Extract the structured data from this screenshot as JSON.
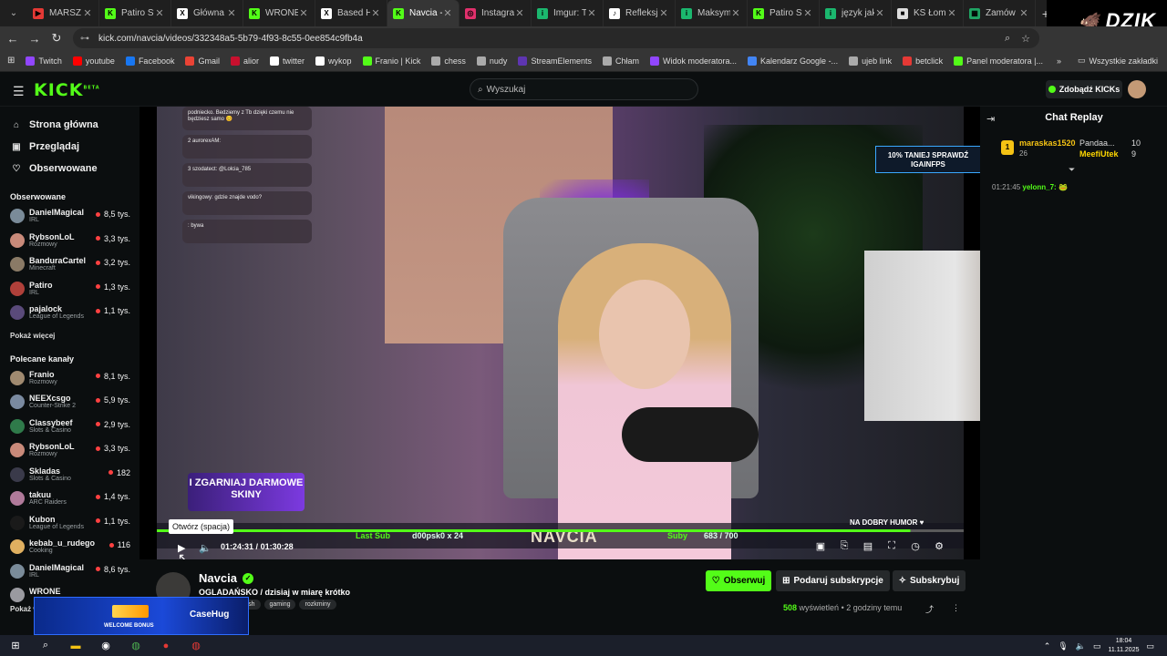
{
  "browser": {
    "tabs": [
      {
        "label": "MARSZ N",
        "color": "#e53935",
        "glyph": "▶"
      },
      {
        "label": "Patiro St",
        "color": "#53fc18",
        "glyph": "K"
      },
      {
        "label": "Główna /",
        "color": "#ffffff",
        "glyph": "X"
      },
      {
        "label": "WRONE",
        "color": "#53fc18",
        "glyph": "K"
      },
      {
        "label": "Based H",
        "color": "#ffffff",
        "glyph": "X"
      },
      {
        "label": "Navcia -",
        "color": "#53fc18",
        "glyph": "K"
      },
      {
        "label": "Instagran",
        "color": "#e1306c",
        "glyph": "◎"
      },
      {
        "label": "Imgur: Th",
        "color": "#1bb76e",
        "glyph": "i"
      },
      {
        "label": "Refleksje",
        "color": "#ffffff",
        "glyph": "♪"
      },
      {
        "label": "Maksym",
        "color": "#1bb76e",
        "glyph": "i"
      },
      {
        "label": "Patiro St",
        "color": "#53fc18",
        "glyph": "K"
      },
      {
        "label": "język jak",
        "color": "#1bb76e",
        "glyph": "i"
      },
      {
        "label": "KS Łomia",
        "color": "#dddddd",
        "glyph": "■"
      },
      {
        "label": "Zamów",
        "color": "#1fa463",
        "glyph": "▦"
      }
    ],
    "active_tab": 5,
    "new_tab": "+",
    "url": "kick.com/navcia/videos/332348a5-5b79-4f93-8c55-0ee854c9fb4a",
    "bookmarks": [
      {
        "label": "Twitch",
        "color": "#9146ff"
      },
      {
        "label": "youtube",
        "color": "#ff0000"
      },
      {
        "label": "Facebook",
        "color": "#1877f2"
      },
      {
        "label": "Gmail",
        "color": "#ea4335"
      },
      {
        "label": "alior",
        "color": "#c8102e"
      },
      {
        "label": "twitter",
        "color": "#ffffff"
      },
      {
        "label": "wykop",
        "color": "#ffffff"
      },
      {
        "label": "Franio | Kick",
        "color": "#53fc18"
      },
      {
        "label": "chess",
        "color": "#aaaaaa"
      },
      {
        "label": "nudy",
        "color": "#aaaaaa"
      },
      {
        "label": "StreamElements",
        "color": "#5e35b1"
      },
      {
        "label": "Chłam",
        "color": "#aaaaaa"
      },
      {
        "label": "Widok moderatora...",
        "color": "#9146ff"
      },
      {
        "label": "Kalendarz Google -...",
        "color": "#4285f4"
      },
      {
        "label": "ujeb link",
        "color": "#aaaaaa"
      },
      {
        "label": "betclick",
        "color": "#e53935"
      },
      {
        "label": "Panel moderatora |...",
        "color": "#53fc18"
      }
    ],
    "all_bookmarks": "Wszystkie zakładki",
    "dzik_logo": "DZIK"
  },
  "header": {
    "logo": "KICK",
    "logo_sup": "BETA",
    "search_placeholder": "Wyszukaj",
    "kicks_label": "Zdobądź KICKs"
  },
  "sidebar": {
    "nav": [
      {
        "label": "Strona główna",
        "icon": "home-icon",
        "glyph": "⌂"
      },
      {
        "label": "Przeglądaj",
        "icon": "browse-icon",
        "glyph": "▣"
      },
      {
        "label": "Obserwowane",
        "icon": "heart-icon",
        "glyph": "♡"
      }
    ],
    "followed_title": "Obserwowane",
    "followed": [
      {
        "name": "DanielMagical",
        "cat": "IRL",
        "viewers": "8,5 tys.",
        "color": "#7a8b99"
      },
      {
        "name": "RybsonLoL",
        "cat": "Rozmowy",
        "viewers": "3,3 tys.",
        "color": "#c98a7a"
      },
      {
        "name": "BanduraCartel",
        "cat": "Minecraft",
        "viewers": "3,2 tys.",
        "color": "#8a7a66"
      },
      {
        "name": "Patiro",
        "cat": "IRL",
        "viewers": "1,3 tys.",
        "color": "#b0403a"
      },
      {
        "name": "pajalock",
        "cat": "League of Legends",
        "viewers": "1,1 tys.",
        "color": "#5a4a7a"
      }
    ],
    "show_more": "Pokaż więcej",
    "recommended_title": "Polecane kanały",
    "recommended": [
      {
        "name": "Franio",
        "cat": "Rozmowy",
        "viewers": "8,1 tys.",
        "color": "#a08a70"
      },
      {
        "name": "NEEXcsgo",
        "cat": "Counter-Strike 2",
        "viewers": "5,9 tys.",
        "color": "#7a8aa0"
      },
      {
        "name": "Classybeef",
        "cat": "Slots & Casino",
        "viewers": "2,9 tys.",
        "color": "#2f7a4a"
      },
      {
        "name": "RybsonLoL",
        "cat": "Rozmowy",
        "viewers": "3,3 tys.",
        "color": "#c98a7a"
      },
      {
        "name": "Skladas",
        "cat": "Slots & Casino",
        "viewers": "182",
        "color": "#3a3a4a"
      },
      {
        "name": "takuu",
        "cat": "ARC Raiders",
        "viewers": "1,4 tys.",
        "color": "#b07a9a"
      },
      {
        "name": "Kubon",
        "cat": "League of Legends",
        "viewers": "1,1 tys.",
        "color": "#1a1a1a"
      },
      {
        "name": "kebab_u_rudego",
        "cat": "Cooking",
        "viewers": "116",
        "color": "#e0b060"
      },
      {
        "name": "DanielMagical",
        "cat": "IRL",
        "viewers": "8,6 tys.",
        "color": "#7a8b99"
      },
      {
        "name": "WRONE",
        "cat": "",
        "viewers": "",
        "color": "#9a9aa0"
      }
    ],
    "show_more_2": "Pokaż w"
  },
  "player": {
    "overlay_chat": [
      {
        "text": "podniecko. Bedziemy z Tb dzięki czemu nie będziesz samo 😊"
      },
      {
        "text": "2 aurorexAM:"
      },
      {
        "text": "3 szodatect: @Lolcia_785"
      },
      {
        "text": "vikingowy: gdzie znajde vodo?"
      },
      {
        "text": ": bywa"
      }
    ],
    "promo_left": "I ZGARNIAJ DARMOWE SKINY",
    "promo_right": "10% TANIEJ SPRAWDŹ IGAINFPS",
    "last_sub_label": "Last Sub",
    "last_sub_value": "d00psk0 x 24",
    "streamer_banner": "NAVCIA",
    "subs_label": "Suby",
    "subs_value": "683 / 700",
    "humor": "NA DOBRY HUMOR ♥",
    "tooltip": "Otwórz (spacja)",
    "time_current": "01:24:31",
    "time_sep": "/",
    "time_total": "01:30:28",
    "progress": 0.934
  },
  "chat": {
    "title": "Chat Replay",
    "pinned_rank": "1",
    "pinned_user": "maraskas1520",
    "pinned_count": "26",
    "second_user": "Pandaa...",
    "second_count": "10",
    "third_user": "MeefiUtek",
    "third_count": "9",
    "msg_time": "01:21:45",
    "msg_user": "yelonn_7:"
  },
  "stream": {
    "name": "Navcia",
    "title": "OGLADAŃSKO / dzisiaj w miarę krótko",
    "tags": [
      "lish",
      "gaming",
      "rozkminy"
    ],
    "follow": "Obserwuj",
    "gift": "Podaruj subskrypcje",
    "subscribe": "Subskrybuj",
    "views_count": "508",
    "views_label": "wyświetleń",
    "time_ago": "2 godziny temu"
  },
  "ad": {
    "welcome": "WELCOME BONUS",
    "brand": "CaseHug"
  },
  "taskbar": {
    "time": "18:04",
    "date": "11.11.2025"
  }
}
